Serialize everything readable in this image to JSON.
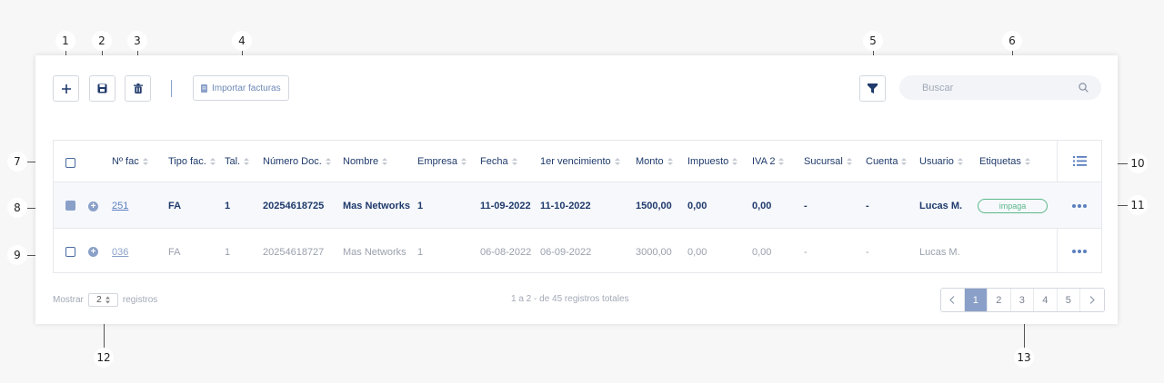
{
  "callouts": [
    "1",
    "2",
    "3",
    "4",
    "5",
    "6",
    "7",
    "8",
    "9",
    "10",
    "11",
    "12",
    "13"
  ],
  "toolbar": {
    "add_icon": "plus-icon",
    "save_icon": "save-icon",
    "delete_icon": "trash-icon",
    "import_label": "Importar facturas",
    "filter_icon": "filter-icon"
  },
  "search": {
    "placeholder": "Buscar"
  },
  "table": {
    "columns": [
      "Nº fac",
      "Tipo fac.",
      "Tal.",
      "Número Doc.",
      "Nombre",
      "Empresa",
      "Fecha",
      "1er vencimiento",
      "Monto",
      "Impuesto",
      "IVA 2",
      "Sucursal",
      "Cuenta",
      "Usuario",
      "Etiquetas"
    ],
    "rows": [
      {
        "selected": true,
        "cells": [
          "251",
          "FA",
          "1",
          "20254618725",
          "Mas Networks",
          "1",
          "11-09-2022",
          "11-10-2022",
          "1500,00",
          "0,00",
          "0,00",
          "-",
          "-",
          "Lucas M."
        ],
        "tag": "impaga"
      },
      {
        "selected": false,
        "cells": [
          "036",
          "FA",
          "1",
          "20254618727",
          "Mas Networks",
          "1",
          "06-08-2022",
          "06-09-2022",
          "3000,00",
          "0,00",
          "0,00",
          "-",
          "-",
          "Lucas M."
        ],
        "tag": ""
      }
    ]
  },
  "footer": {
    "show_label": "Mostrar",
    "show_value": "2",
    "records_label": "registros",
    "summary": "1 a 2 - de 45 registros totales",
    "pages": [
      "1",
      "2",
      "3",
      "4",
      "5"
    ],
    "current_page": "1"
  },
  "colors": {
    "accent": "#8aa0c8",
    "navy": "#1f3a6b",
    "tag_green": "#5cb88a"
  }
}
